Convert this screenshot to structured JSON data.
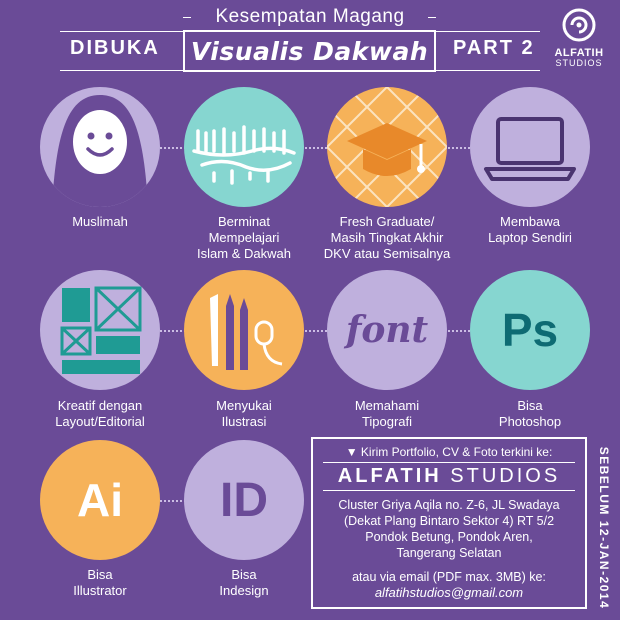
{
  "header": {
    "top_text": "Kesempatan Magang",
    "left_text": "DIBUKA",
    "title": "Visualis Dakwah",
    "right_text": "PART 2"
  },
  "logo": {
    "name": "ALFATIH",
    "sub": "STUDIOS"
  },
  "items": [
    {
      "label": "Muslimah",
      "icon": "hijab-face-icon"
    },
    {
      "label": "Berminat\nMempelajari\nIslam & Dakwah",
      "icon": "shahada-calligraphy-icon"
    },
    {
      "label": "Fresh Graduate/\nMasih Tingkat Akhir\nDKV atau Semisalnya",
      "icon": "graduation-cap-icon"
    },
    {
      "label": "Membawa\nLaptop Sendiri",
      "icon": "laptop-icon"
    },
    {
      "label": "Kreatif dengan\nLayout/Editorial",
      "icon": "layout-grid-icon"
    },
    {
      "label": "Menyukai\nIlustrasi",
      "icon": "drawing-tools-icon"
    },
    {
      "label": "Memahami\nTipografi",
      "icon": "font-icon",
      "icon_text": "font"
    },
    {
      "label": "Bisa\nPhotoshop",
      "icon": "photoshop-icon",
      "icon_text": "Ps"
    },
    {
      "label": "Bisa\nIllustrator",
      "icon": "illustrator-icon",
      "icon_text": "Ai"
    },
    {
      "label": "Bisa\nIndesign",
      "icon": "indesign-icon",
      "icon_text": "ID"
    }
  ],
  "info": {
    "heading": "Kirim Portfolio, CV & Foto terkini ke:",
    "brand_bold": "ALFATIH",
    "brand_light": "STUDIOS",
    "address": "Cluster Griya Aqila no. Z-6, JL Swadaya\n(Dekat Plang Bintaro Sektor 4) RT 5/2\nPondok Betung, Pondok Aren,\nTangerang Selatan",
    "email_note": "atau via email (PDF max. 3MB) ke:",
    "email": "alfatihstudios@gmail.com"
  },
  "deadline": "SEBELUM 12-JAN-2014",
  "colors": {
    "background": "#6a4b97",
    "circle_lavender": "#bfb0dd",
    "circle_teal": "#86d6d0",
    "circle_orange": "#f6b259",
    "accent_orange": "#f4a540",
    "accent_teal": "#0e6b73"
  }
}
